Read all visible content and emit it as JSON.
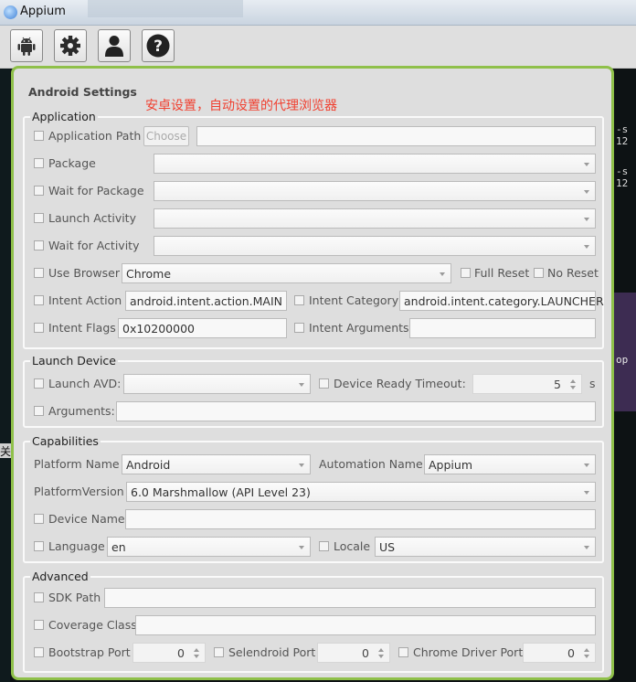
{
  "window": {
    "title": "Appium"
  },
  "toolbar": {
    "buttons": [
      {
        "name": "android-settings",
        "icon": "android-icon"
      },
      {
        "name": "general-settings",
        "icon": "gear-icon"
      },
      {
        "name": "developer-settings",
        "icon": "person-icon"
      },
      {
        "name": "about",
        "icon": "question-icon"
      }
    ]
  },
  "terminal": {
    "side_fragments": [
      "-s 12",
      "-s 12",
      "op"
    ],
    "left_fragment": "关"
  },
  "panel": {
    "title": "Android Settings",
    "annotation": "安卓设置，自动设置的代理浏览器"
  },
  "application": {
    "label": "Application",
    "app_path": {
      "label": "Application Path",
      "button": "Choose",
      "value": ""
    },
    "package": {
      "label": "Package",
      "value": ""
    },
    "wait_package": {
      "label": "Wait for Package",
      "value": ""
    },
    "launch_activity": {
      "label": "Launch Activity",
      "value": ""
    },
    "wait_activity": {
      "label": "Wait for Activity",
      "value": ""
    },
    "use_browser": {
      "label": "Use Browser",
      "value": "Chrome"
    },
    "full_reset": {
      "label": "Full Reset"
    },
    "no_reset": {
      "label": "No Reset"
    },
    "intent_action": {
      "label": "Intent Action",
      "value": "android.intent.action.MAIN"
    },
    "intent_category": {
      "label": "Intent Category",
      "value": "android.intent.category.LAUNCHER"
    },
    "intent_flags": {
      "label": "Intent Flags",
      "value": "0x10200000"
    },
    "intent_arguments": {
      "label": "Intent Arguments",
      "value": ""
    }
  },
  "launch_device": {
    "label": "Launch Device",
    "launch_avd": {
      "label": "Launch AVD:",
      "value": ""
    },
    "ready_timeout": {
      "label": "Device Ready Timeout:",
      "value": "5",
      "unit": "s"
    },
    "arguments": {
      "label": "Arguments:",
      "value": ""
    }
  },
  "capabilities": {
    "label": "Capabilities",
    "platform_name": {
      "label": "Platform Name",
      "value": "Android"
    },
    "automation_name": {
      "label": "Automation Name",
      "value": "Appium"
    },
    "platform_version": {
      "label": "PlatformVersion",
      "value": "6.0 Marshmallow (API Level 23)"
    },
    "device_name": {
      "label": "Device Name",
      "value": ""
    },
    "language": {
      "label": "Language",
      "value": "en"
    },
    "locale": {
      "label": "Locale",
      "value": "US"
    }
  },
  "advanced": {
    "label": "Advanced",
    "sdk_path": {
      "label": "SDK Path",
      "value": ""
    },
    "coverage_class": {
      "label": "Coverage Class",
      "value": ""
    },
    "bootstrap_port": {
      "label": "Bootstrap Port",
      "value": "0"
    },
    "selendroid_port": {
      "label": "Selendroid Port",
      "value": "0"
    },
    "chromedriver_port": {
      "label": "Chrome Driver Port",
      "value": "0"
    }
  }
}
